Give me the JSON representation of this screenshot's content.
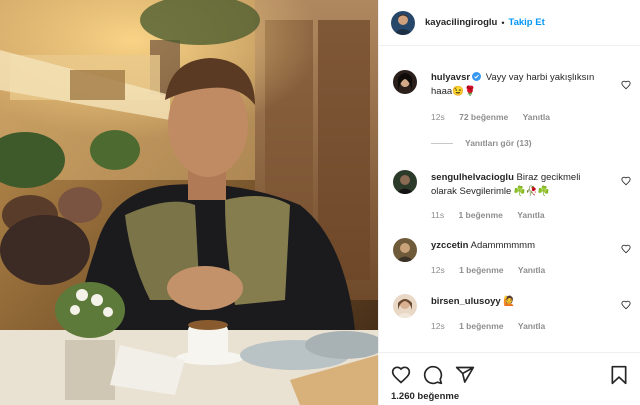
{
  "post": {
    "author": "kayacilingiroglu",
    "follow_label": "Takip Et",
    "separator": "•",
    "likes": "1.260 beğenme"
  },
  "comments": [
    {
      "user": "hulyavsr",
      "verified": true,
      "text": "Vayy vay harbi yakışlıksın haaa😉🌹",
      "time": "12s",
      "likes": "72 beğenme",
      "reply": "Yanıtla",
      "view_replies": "Yanıtları gör (13)"
    },
    {
      "user": "sengulhelvacioglu",
      "verified": false,
      "text": "Biraz gecikmeli olarak Sevgilerimle ☘️🥀☘️",
      "time": "11s",
      "likes": "1 beğenme",
      "reply": "Yanıtla"
    },
    {
      "user": "yzccetin",
      "verified": false,
      "text": "Adammmmmm",
      "time": "12s",
      "likes": "1 beğenme",
      "reply": "Yanıtla"
    },
    {
      "user": "birsen_ulusoyy",
      "verified": false,
      "text": "🙋",
      "time": "12s",
      "likes": "1 beğenme",
      "reply": "Yanıtla"
    }
  ],
  "icons": {
    "like": "heart-outline-icon",
    "comment": "comment-bubble-icon",
    "share": "paper-plane-icon",
    "save": "bookmark-icon",
    "comment_like": "small-heart-icon",
    "verified": "verified-badge-icon"
  },
  "colors": {
    "link_blue": "#0095f6",
    "muted_text": "#8e8e8e",
    "text": "#262626",
    "border": "#efefef"
  }
}
